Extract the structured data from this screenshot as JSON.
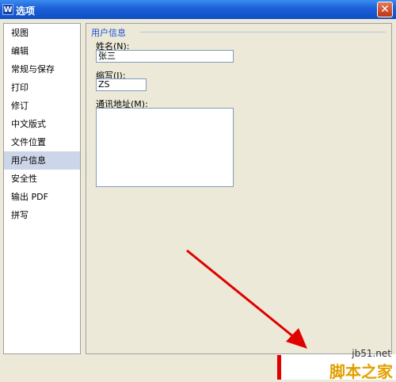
{
  "window": {
    "title": "选项",
    "icon_glyph": "W",
    "close_glyph": "✕"
  },
  "nav": {
    "items": [
      {
        "label": "视图"
      },
      {
        "label": "编辑"
      },
      {
        "label": "常规与保存"
      },
      {
        "label": "打印"
      },
      {
        "label": "修订"
      },
      {
        "label": "中文版式"
      },
      {
        "label": "文件位置"
      },
      {
        "label": "用户信息",
        "selected": true
      },
      {
        "label": "安全性"
      },
      {
        "label": "输出 PDF"
      },
      {
        "label": "拼写"
      }
    ]
  },
  "user_info": {
    "group_title": "用户信息",
    "name_label": "姓名(N):",
    "name_value": "张三",
    "initials_label": "缩写(I):",
    "initials_value": "ZS",
    "address_label": "通讯地址(M):",
    "address_value": ""
  },
  "watermark": {
    "url": "jb51.net",
    "name": "脚本之家"
  },
  "colors": {
    "accent_red": "#e00000",
    "selection": "#cdd5e8",
    "group_title": "#1a50d0"
  }
}
